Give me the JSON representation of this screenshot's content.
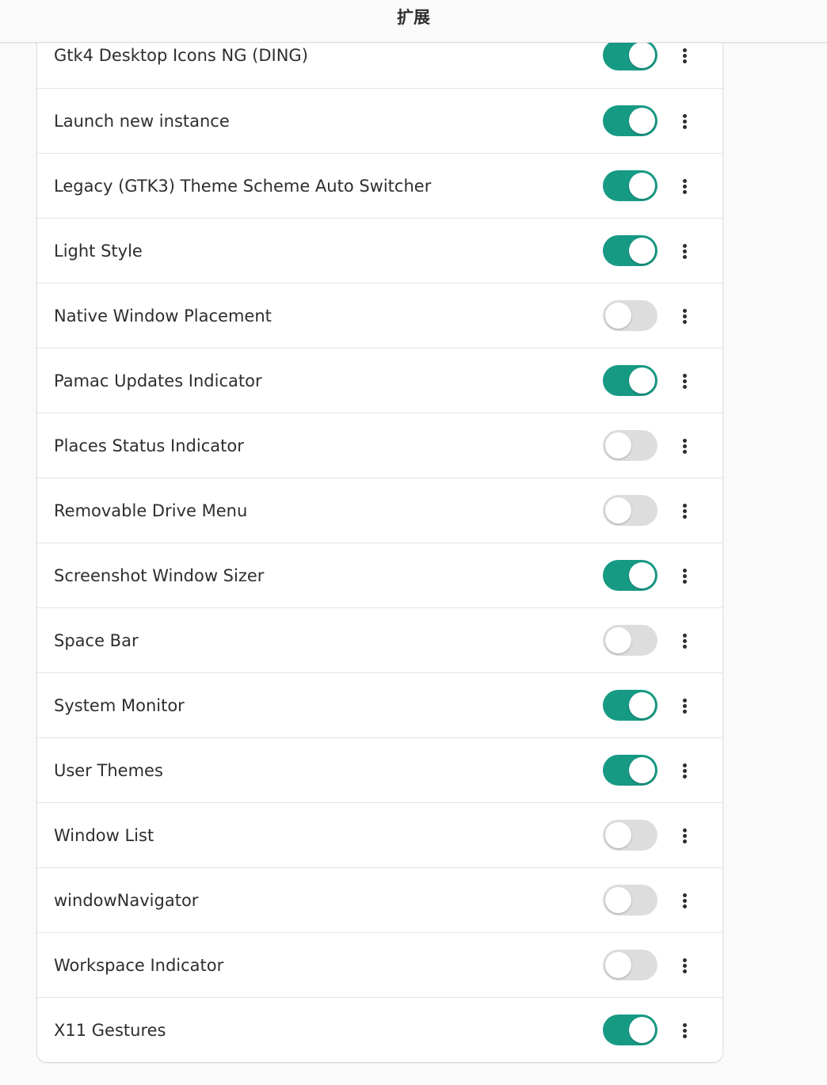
{
  "header": {
    "title": "扩展"
  },
  "colors": {
    "toggle_on": "#179a84",
    "toggle_off": "#dddddd"
  },
  "extensions": [
    {
      "name": "Gtk4 Desktop Icons NG (DING)",
      "enabled": true,
      "menu_icon": "view-more-icon"
    },
    {
      "name": "Launch new instance",
      "enabled": true,
      "menu_icon": "view-more-icon"
    },
    {
      "name": "Legacy (GTK3) Theme Scheme Auto Switcher",
      "enabled": true,
      "menu_icon": "view-more-icon"
    },
    {
      "name": "Light Style",
      "enabled": true,
      "menu_icon": "view-more-icon"
    },
    {
      "name": "Native Window Placement",
      "enabled": false,
      "menu_icon": "view-more-icon"
    },
    {
      "name": "Pamac Updates Indicator",
      "enabled": true,
      "menu_icon": "view-more-icon"
    },
    {
      "name": "Places Status Indicator",
      "enabled": false,
      "menu_icon": "view-more-icon"
    },
    {
      "name": "Removable Drive Menu",
      "enabled": false,
      "menu_icon": "view-more-icon"
    },
    {
      "name": "Screenshot Window Sizer",
      "enabled": true,
      "menu_icon": "view-more-icon"
    },
    {
      "name": "Space Bar",
      "enabled": false,
      "menu_icon": "view-more-icon"
    },
    {
      "name": "System Monitor",
      "enabled": true,
      "menu_icon": "view-more-icon"
    },
    {
      "name": "User Themes",
      "enabled": true,
      "menu_icon": "view-more-icon"
    },
    {
      "name": "Window List",
      "enabled": false,
      "menu_icon": "view-more-icon"
    },
    {
      "name": "windowNavigator",
      "enabled": false,
      "menu_icon": "view-more-icon"
    },
    {
      "name": "Workspace Indicator",
      "enabled": false,
      "menu_icon": "view-more-icon"
    },
    {
      "name": "X11 Gestures",
      "enabled": true,
      "menu_icon": "view-more-icon"
    }
  ]
}
